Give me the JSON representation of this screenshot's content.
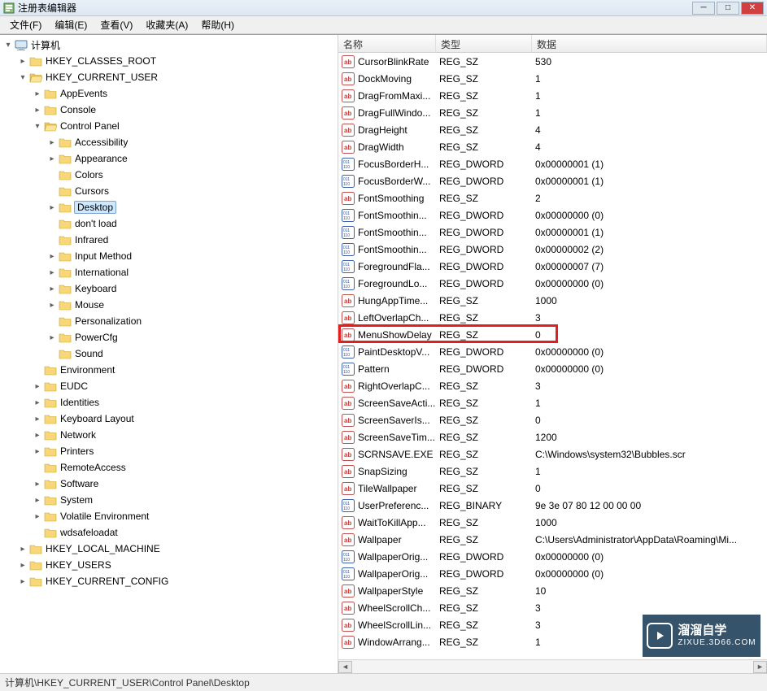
{
  "window": {
    "title": "注册表编辑器"
  },
  "menu": {
    "file": "文件(F)",
    "edit": "编辑(E)",
    "view": "查看(V)",
    "favorites": "收藏夹(A)",
    "help": "帮助(H)"
  },
  "tree": {
    "root": "计算机",
    "hkcr": "HKEY_CLASSES_ROOT",
    "hkcu": "HKEY_CURRENT_USER",
    "hkcu_children": {
      "appevents": "AppEvents",
      "console": "Console",
      "controlpanel": "Control Panel",
      "cp_children": [
        "Accessibility",
        "Appearance",
        "Colors",
        "Cursors",
        "Desktop",
        "don't load",
        "Infrared",
        "Input Method",
        "International",
        "Keyboard",
        "Mouse",
        "Personalization",
        "PowerCfg",
        "Sound"
      ],
      "environment": "Environment",
      "eudc": "EUDC",
      "identities": "Identities",
      "keyboard_layout": "Keyboard Layout",
      "network": "Network",
      "printers": "Printers",
      "remoteaccess": "RemoteAccess",
      "software": "Software",
      "system": "System",
      "volatile": "Volatile Environment",
      "wdsafeloadat": "wdsafeloadat"
    },
    "hklm": "HKEY_LOCAL_MACHINE",
    "hku": "HKEY_USERS",
    "hkcc": "HKEY_CURRENT_CONFIG",
    "selected": "Desktop"
  },
  "list": {
    "headers": {
      "name": "名称",
      "type": "类型",
      "data": "数据"
    },
    "rows": [
      {
        "icon": "sz",
        "name": "CursorBlinkRate",
        "type": "REG_SZ",
        "data": "530"
      },
      {
        "icon": "sz",
        "name": "DockMoving",
        "type": "REG_SZ",
        "data": "1"
      },
      {
        "icon": "sz",
        "name": "DragFromMaxi...",
        "type": "REG_SZ",
        "data": "1"
      },
      {
        "icon": "sz",
        "name": "DragFullWindo...",
        "type": "REG_SZ",
        "data": "1"
      },
      {
        "icon": "sz",
        "name": "DragHeight",
        "type": "REG_SZ",
        "data": "4"
      },
      {
        "icon": "sz",
        "name": "DragWidth",
        "type": "REG_SZ",
        "data": "4"
      },
      {
        "icon": "bin",
        "name": "FocusBorderH...",
        "type": "REG_DWORD",
        "data": "0x00000001 (1)"
      },
      {
        "icon": "bin",
        "name": "FocusBorderW...",
        "type": "REG_DWORD",
        "data": "0x00000001 (1)"
      },
      {
        "icon": "sz",
        "name": "FontSmoothing",
        "type": "REG_SZ",
        "data": "2"
      },
      {
        "icon": "bin",
        "name": "FontSmoothin...",
        "type": "REG_DWORD",
        "data": "0x00000000 (0)"
      },
      {
        "icon": "bin",
        "name": "FontSmoothin...",
        "type": "REG_DWORD",
        "data": "0x00000001 (1)"
      },
      {
        "icon": "bin",
        "name": "FontSmoothin...",
        "type": "REG_DWORD",
        "data": "0x00000002 (2)"
      },
      {
        "icon": "bin",
        "name": "ForegroundFla...",
        "type": "REG_DWORD",
        "data": "0x00000007 (7)"
      },
      {
        "icon": "bin",
        "name": "ForegroundLo...",
        "type": "REG_DWORD",
        "data": "0x00000000 (0)"
      },
      {
        "icon": "sz",
        "name": "HungAppTime...",
        "type": "REG_SZ",
        "data": "1000"
      },
      {
        "icon": "sz",
        "name": "LeftOverlapCh...",
        "type": "REG_SZ",
        "data": "3"
      },
      {
        "icon": "sz",
        "name": "MenuShowDelay",
        "type": "REG_SZ",
        "data": "0",
        "highlight": true
      },
      {
        "icon": "bin",
        "name": "PaintDesktopV...",
        "type": "REG_DWORD",
        "data": "0x00000000 (0)"
      },
      {
        "icon": "bin",
        "name": "Pattern",
        "type": "REG_DWORD",
        "data": "0x00000000 (0)"
      },
      {
        "icon": "sz",
        "name": "RightOverlapC...",
        "type": "REG_SZ",
        "data": "3"
      },
      {
        "icon": "sz",
        "name": "ScreenSaveActi...",
        "type": "REG_SZ",
        "data": "1"
      },
      {
        "icon": "sz",
        "name": "ScreenSaverIs...",
        "type": "REG_SZ",
        "data": "0"
      },
      {
        "icon": "sz",
        "name": "ScreenSaveTim...",
        "type": "REG_SZ",
        "data": "1200"
      },
      {
        "icon": "sz",
        "name": "SCRNSAVE.EXE",
        "type": "REG_SZ",
        "data": "C:\\Windows\\system32\\Bubbles.scr"
      },
      {
        "icon": "sz",
        "name": "SnapSizing",
        "type": "REG_SZ",
        "data": "1"
      },
      {
        "icon": "sz",
        "name": "TileWallpaper",
        "type": "REG_SZ",
        "data": "0"
      },
      {
        "icon": "bin",
        "name": "UserPreferenc...",
        "type": "REG_BINARY",
        "data": "9e 3e 07 80 12 00 00 00"
      },
      {
        "icon": "sz",
        "name": "WaitToKillApp...",
        "type": "REG_SZ",
        "data": "1000"
      },
      {
        "icon": "sz",
        "name": "Wallpaper",
        "type": "REG_SZ",
        "data": "C:\\Users\\Administrator\\AppData\\Roaming\\Mi..."
      },
      {
        "icon": "bin",
        "name": "WallpaperOrig...",
        "type": "REG_DWORD",
        "data": "0x00000000 (0)"
      },
      {
        "icon": "bin",
        "name": "WallpaperOrig...",
        "type": "REG_DWORD",
        "data": "0x00000000 (0)"
      },
      {
        "icon": "sz",
        "name": "WallpaperStyle",
        "type": "REG_SZ",
        "data": "10"
      },
      {
        "icon": "sz",
        "name": "WheelScrollCh...",
        "type": "REG_SZ",
        "data": "3"
      },
      {
        "icon": "sz",
        "name": "WheelScrollLin...",
        "type": "REG_SZ",
        "data": "3"
      },
      {
        "icon": "sz",
        "name": "WindowArrang...",
        "type": "REG_SZ",
        "data": "1"
      }
    ]
  },
  "statusbar": {
    "path": "计算机\\HKEY_CURRENT_USER\\Control Panel\\Desktop"
  },
  "watermark": {
    "main": "溜溜自学",
    "sub": "ZIXUE.3D66.COM"
  }
}
